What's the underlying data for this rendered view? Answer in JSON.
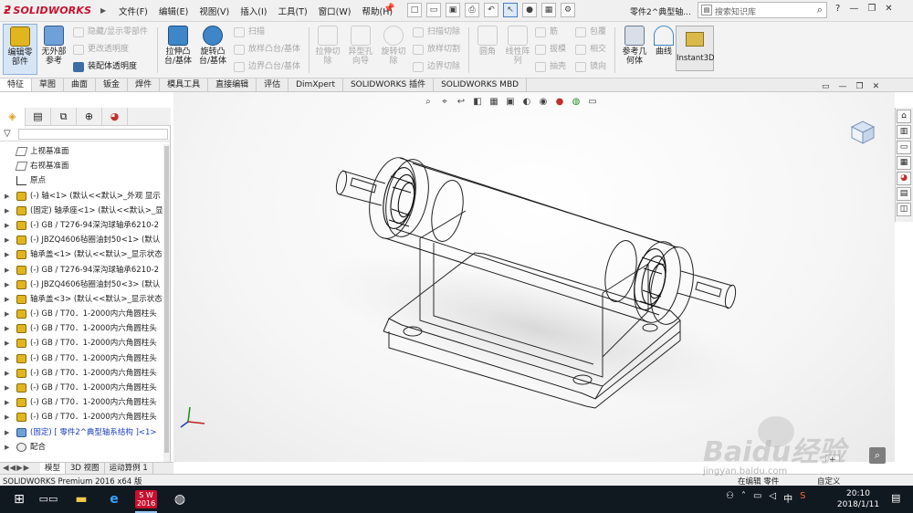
{
  "app": {
    "logo_text": "SOLIDWORKS",
    "menus": [
      "文件(F)",
      "编辑(E)",
      "视图(V)",
      "插入(I)",
      "工具(T)",
      "窗口(W)",
      "帮助(H)"
    ],
    "document_title": "零件2^典型轴...",
    "help_search_placeholder": "搜索知识库",
    "help_label": "?"
  },
  "ribbon": {
    "edit_component": "编辑零\n部件",
    "no_external_refs": "无外部\n参考",
    "hide_show_components": "隐藏/显示零部件",
    "change_transparency": "更改透明度",
    "assembly_transparency": "装配体透明度",
    "extrude_boss": "拉伸凸\n台/基体",
    "revolve_boss": "旋转凸\n台/基体",
    "sweep": "扫描",
    "loft_boss": "放样凸台/基体",
    "boundary_boss": "边界凸台/基体",
    "extrude_cut": "拉伸切\n除",
    "hole_wizard": "异型孔\n向导",
    "revolve_cut": "旋转切\n除",
    "swept_cut": "扫描切除",
    "lofted_cut": "放样切割",
    "boundary_cut": "边界切除",
    "fillet": "圆角",
    "linear_pattern": "线性阵\n列",
    "rib": "筋",
    "draft": "拔模",
    "shell": "抽壳",
    "wrap": "包覆",
    "intersect": "相交",
    "mirror": "镜向",
    "reference_geometry": "参考几\n何体",
    "curves": "曲线",
    "instant3d": "Instant3D"
  },
  "command_tabs": [
    "特征",
    "草图",
    "曲面",
    "钣金",
    "焊件",
    "模具工具",
    "直接编辑",
    "评估",
    "DimXpert",
    "SOLIDWORKS 插件",
    "SOLIDWORKS MBD"
  ],
  "feature_tree": [
    {
      "label": "上视基准面",
      "icon": "plane-icon",
      "expandable": false
    },
    {
      "label": "右视基准面",
      "icon": "plane-icon",
      "expandable": false
    },
    {
      "label": "原点",
      "icon": "origin-icon",
      "expandable": false
    },
    {
      "label": "(-) 轴<1> (默认<<默认>_外观 显示",
      "icon": "part-icon",
      "expandable": true
    },
    {
      "label": "(固定) 轴承座<1> (默认<<默认>_显",
      "icon": "part-icon",
      "expandable": true
    },
    {
      "label": "(-) GB / T276-94深沟球轴承6210-2",
      "icon": "part-icon",
      "expandable": true
    },
    {
      "label": "(-) JBZQ4606毡圈油封50<1> (默认",
      "icon": "part-icon",
      "expandable": true
    },
    {
      "label": "轴承盖<1> (默认<<默认>_显示状态",
      "icon": "part-icon",
      "expandable": true
    },
    {
      "label": "(-) GB / T276-94深沟球轴承6210-2",
      "icon": "part-icon",
      "expandable": true
    },
    {
      "label": "(-) JBZQ4606毡圈油封50<3> (默认",
      "icon": "part-icon",
      "expandable": true
    },
    {
      "label": "轴承盖<3> (默认<<默认>_显示状态",
      "icon": "part-icon",
      "expandable": true
    },
    {
      "label": "(-) GB / T70．1-2000内六角圆柱头",
      "icon": "part-icon",
      "expandable": true
    },
    {
      "label": "(-) GB / T70．1-2000内六角圆柱头",
      "icon": "part-icon",
      "expandable": true
    },
    {
      "label": "(-) GB / T70．1-2000内六角圆柱头",
      "icon": "part-icon",
      "expandable": true
    },
    {
      "label": "(-) GB / T70．1-2000内六角圆柱头",
      "icon": "part-icon",
      "expandable": true
    },
    {
      "label": "(-) GB / T70．1-2000内六角圆柱头",
      "icon": "part-icon",
      "expandable": true
    },
    {
      "label": "(-) GB / T70．1-2000内六角圆柱头",
      "icon": "part-icon",
      "expandable": true
    },
    {
      "label": "(-) GB / T70．1-2000内六角圆柱头",
      "icon": "part-icon",
      "expandable": true
    },
    {
      "label": "(-) GB / T70．1-2000内六角圆柱头",
      "icon": "part-icon",
      "expandable": true
    },
    {
      "label": "(固定) [ 零件2^典型轴系结构 ]<1>",
      "icon": "assembly-icon",
      "expandable": true,
      "highlight": true
    },
    {
      "label": "配合",
      "icon": "mate-icon",
      "expandable": true
    }
  ],
  "bottom_tabs": [
    "模型",
    "3D 视图",
    "运动算例 1"
  ],
  "status": {
    "left": "SOLIDWORKS Premium 2016 x64 版",
    "middle": "在编辑 零件",
    "right": "自定义"
  },
  "viewport": {
    "zoom_indicator": "+"
  },
  "watermark": {
    "line1": "Baidu经验",
    "line2": "jingyan.baidu.com"
  },
  "taskbar": {
    "sw_label": "S W\n2016",
    "ime_label": "中",
    "time": "20:10",
    "date": "2018/1/11"
  },
  "colors": {
    "accent": "#c8102e",
    "highlight_text": "#1a3fbf",
    "taskbar": "#101820"
  }
}
